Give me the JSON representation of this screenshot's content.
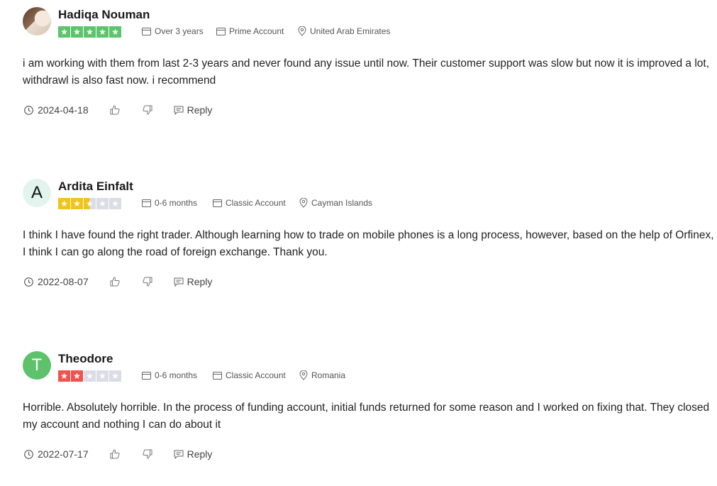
{
  "reviews": [
    {
      "name": "Hadiqa Nouman",
      "avatar_type": "photo",
      "avatar_letter": "",
      "rating": 5,
      "star_color": "#5cc46a",
      "duration": "Over 3 years",
      "account": "Prime Account",
      "location": "United Arab Emirates",
      "text": "i am working with them from last 2-3 years and never found any issue until now. Their customer support was slow but now it is improved a lot, withdrawl is also fast now. i recommend",
      "date": "2024-04-18",
      "reply_label": "Reply"
    },
    {
      "name": "Ardita Einfalt",
      "avatar_type": "letter",
      "avatar_letter": "A",
      "rating": 2.5,
      "star_color": "#f0c419",
      "duration": "0-6 months",
      "account": "Classic Account",
      "location": "Cayman Islands",
      "text": "I think I have found the right trader. Although learning how to trade on mobile phones is a long process, however, based on the help of Orfinex, I think I can go along the road of foreign exchange. Thank you.",
      "date": "2022-08-07",
      "reply_label": "Reply"
    },
    {
      "name": "Theodore",
      "avatar_type": "letter",
      "avatar_letter": "T",
      "rating": 2,
      "star_color": "#ef5350",
      "duration": "0-6 months",
      "account": "Classic Account",
      "location": "Romania",
      "text": "Horrible. Absolutely horrible. In the process of funding account, initial funds returned for some reason and I worked on fixing that. They closed my account and nothing I can do about it",
      "date": "2022-07-17",
      "reply_label": "Reply"
    }
  ]
}
